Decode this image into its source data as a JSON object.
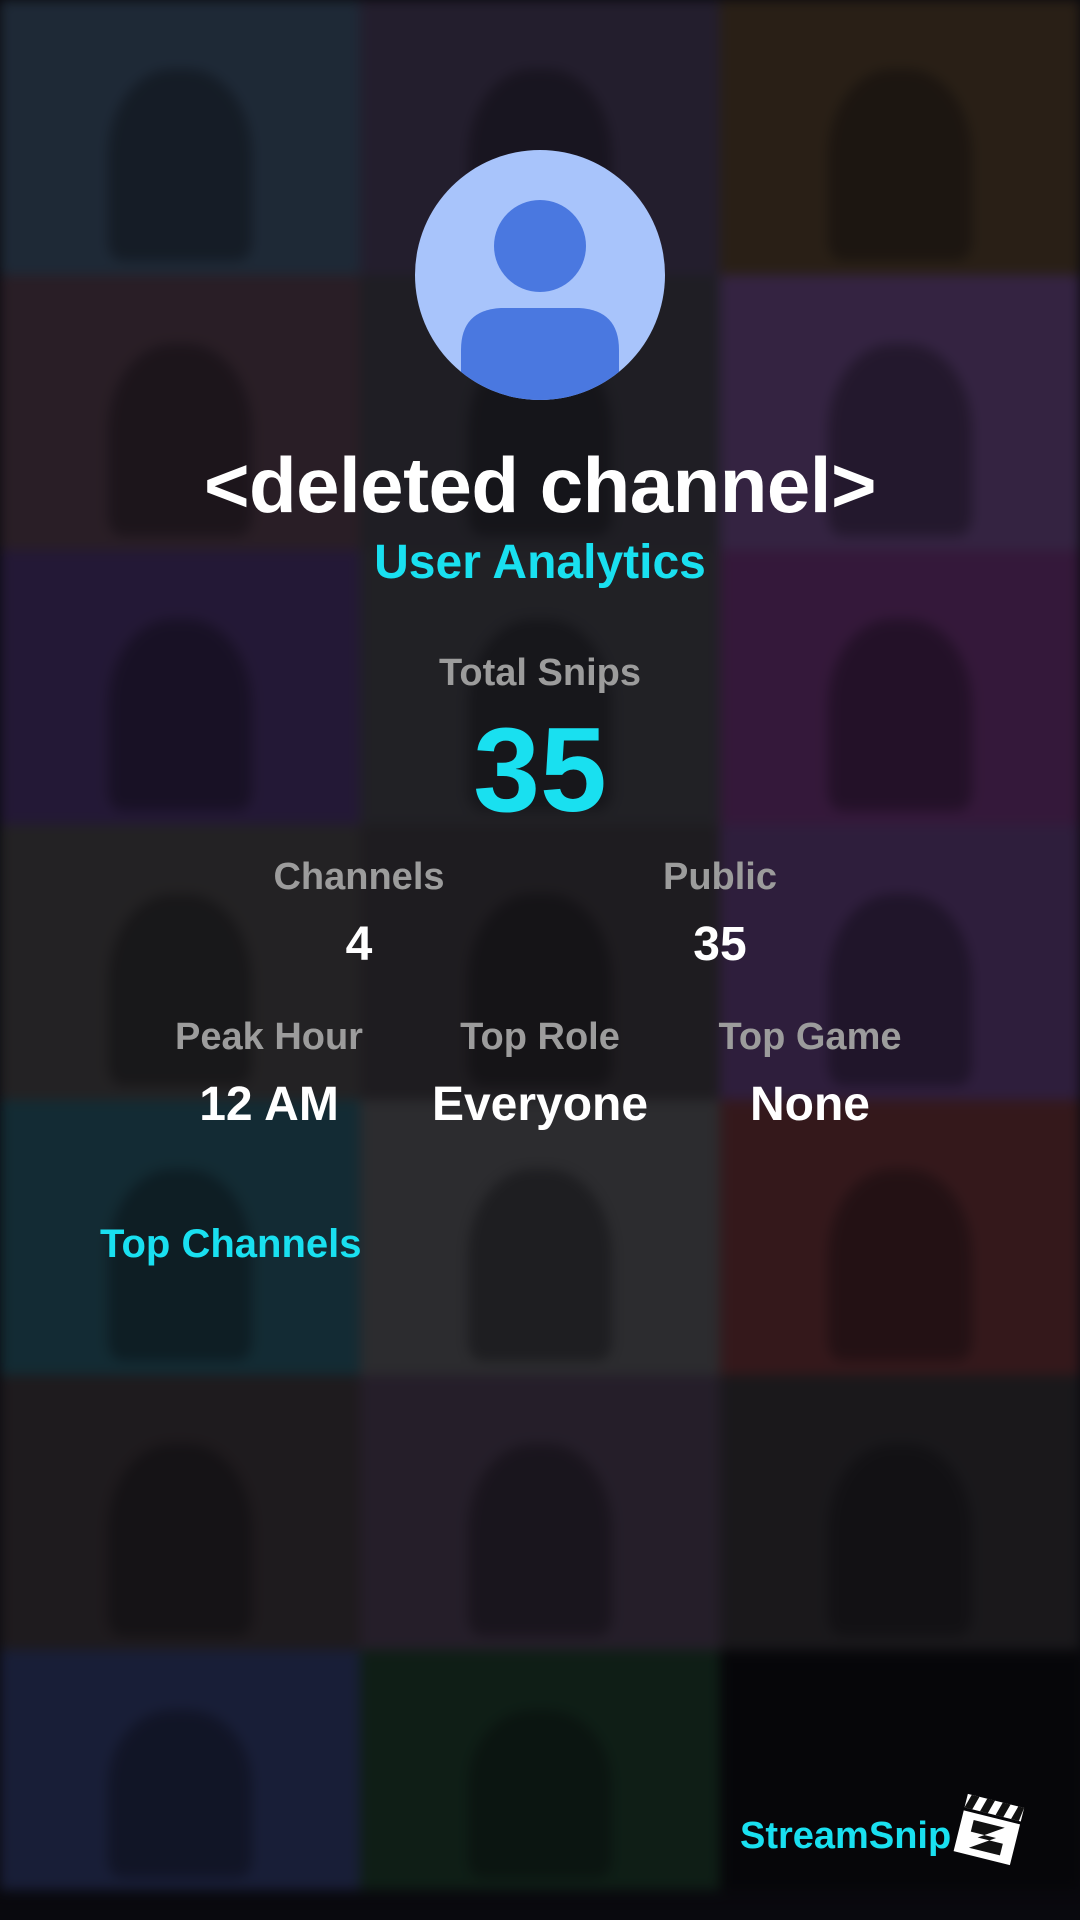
{
  "profile": {
    "channel_name": "<deleted channel>",
    "subtitle": "User Analytics"
  },
  "total": {
    "label": "Total Snips",
    "value": "35"
  },
  "stats_row1": [
    {
      "label": "Channels",
      "value": "4"
    },
    {
      "label": "Public",
      "value": "35"
    }
  ],
  "stats_row2": [
    {
      "label": "Peak Hour",
      "value": "12 AM"
    },
    {
      "label": "Top Role",
      "value": "Everyone"
    },
    {
      "label": "Top Game",
      "value": "None"
    }
  ],
  "sections": {
    "top_channels": "Top Channels"
  },
  "brand": {
    "name": "StreamSnip",
    "logo_icon": "clapperboard-icon"
  },
  "colors": {
    "accent": "#19e0f0",
    "muted_label": "#9c9c9c",
    "avatar_bg": "#a8c4fb",
    "avatar_fg": "#4a78e0"
  }
}
